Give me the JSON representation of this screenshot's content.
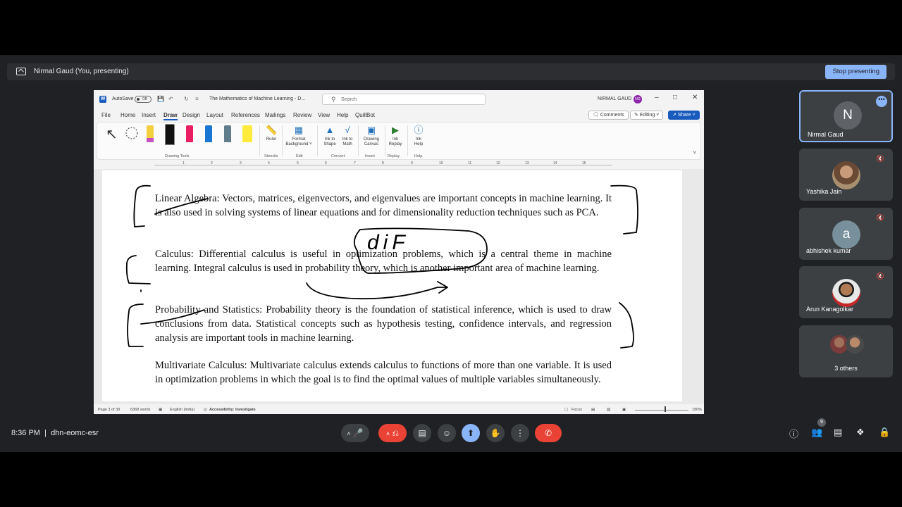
{
  "presenting": {
    "text": "Nirmal Gaud (You, presenting)",
    "stop_label": "Stop presenting"
  },
  "word": {
    "autosave": "AutoSave",
    "toggle": "Off",
    "title": "The Mathematics of Machine Learning - D...",
    "search_placeholder": "Search",
    "user": "NIRMAL GAUD",
    "user_initials": "NG",
    "menu": [
      "File",
      "Home",
      "Insert",
      "Draw",
      "Design",
      "Layout",
      "References",
      "Mailings",
      "Review",
      "View",
      "Help",
      "QuillBot"
    ],
    "active_menu": "Draw",
    "comments": "Comments",
    "editing": "Editing",
    "share": "Share",
    "ribbon": {
      "drawing_tools": "Drawing Tools",
      "ruler": "Ruler",
      "stencils": "Stencils",
      "format_bg": [
        "Format",
        "Background"
      ],
      "edit": "Edit",
      "ink_shape": [
        "Ink to",
        "Shape"
      ],
      "ink_math": [
        "Ink to",
        "Math"
      ],
      "convert": "Convert",
      "drawing_canvas": [
        "Drawing",
        "Canvas"
      ],
      "insert": "Insert",
      "ink_replay": [
        "Ink",
        "Replay"
      ],
      "replay": "Replay",
      "ink_help": [
        "Ink",
        "Help"
      ],
      "help": "Help"
    },
    "ruler_numbers": [
      "1",
      "2",
      "3",
      "4",
      "5",
      "6",
      "7",
      "8",
      "9",
      "10",
      "11",
      "12",
      "13",
      "14",
      "15"
    ],
    "paragraphs": [
      "Linear Algebra: Vectors, matrices, eigenvectors, and eigenvalues are important concepts in machine learning. It is also used in solving systems of linear equations and for dimensionality reduction techniques such as PCA.",
      "Calculus: Differential calculus is useful in optimization problems, which is a central theme in machine learning. Integral calculus is used in probability theory, which is another important area of machine learning.",
      "Probability and Statistics: Probability theory is the foundation of statistical inference, which is used to draw conclusions from data. Statistical concepts such as hypothesis testing, confidence intervals, and regression analysis are important tools in machine learning.",
      "Multivariate Calculus: Multivariate calculus extends calculus to functions of more than one variable. It is used in optimization problems in which the goal is to find the optimal values of multiple variables simultaneously."
    ],
    "ink_text": "diF",
    "status": {
      "page": "Page 3 of 39",
      "words": "6368 words",
      "language": "English (India)",
      "accessibility": "Accessibility: Investigate",
      "focus": "Focus",
      "zoom": "190%"
    }
  },
  "participants": [
    {
      "name": "Nirmal Gaud",
      "initial": "N",
      "color": "#5f6368"
    },
    {
      "name": "Yashika Jain"
    },
    {
      "name": "abhishek kumar",
      "initial": "a",
      "color": "#78909c"
    },
    {
      "name": "Arun Kanagolkar"
    },
    {
      "name": "3 others"
    }
  ],
  "meeting": {
    "time": "8:36 PM",
    "code": "dhn-eomc-esr",
    "people_count": "9"
  },
  "colors": {
    "accent": "#8ab4f8",
    "end_call": "#ea4335",
    "word_blue": "#185abd"
  }
}
